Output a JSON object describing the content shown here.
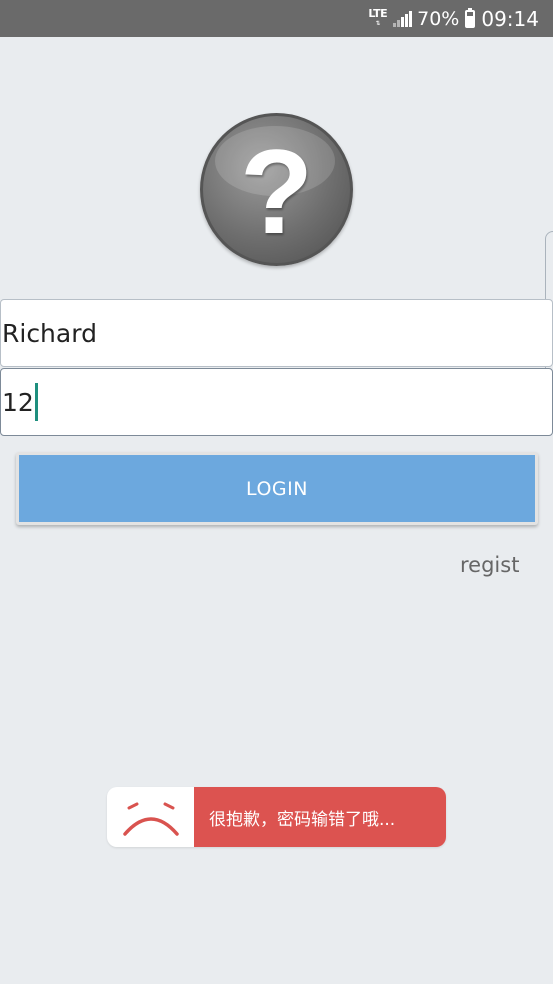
{
  "status_bar": {
    "network": "LTE",
    "battery_percent": "70%",
    "time": "09:14"
  },
  "avatar": {
    "icon": "question-mark-icon",
    "glyph": "?"
  },
  "form": {
    "username_value": "Richard",
    "password_value": "12"
  },
  "login_button": {
    "label": "LOGIN"
  },
  "regist_link": {
    "label": "regist"
  },
  "toast": {
    "icon": "sad-face-icon",
    "message": "很抱歉，密码输错了哦..."
  },
  "colors": {
    "background": "#e9ecef",
    "status_bar": "#6a6a6a",
    "login_button": "#6ca8de",
    "toast_message": "#dc5350",
    "caret": "#1e8f7e"
  }
}
